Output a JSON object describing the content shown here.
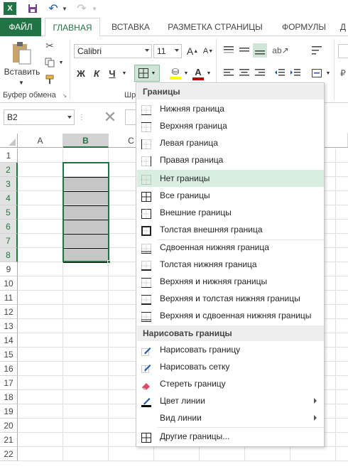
{
  "title_bar": {
    "app_icon": "excel-icon",
    "quick_access": [
      "save-icon",
      "undo-icon",
      "redo-icon"
    ]
  },
  "tabs": [
    "ФАЙЛ",
    "ГЛАВНАЯ",
    "ВСТАВКА",
    "РАЗМЕТКА СТРАНИЦЫ",
    "ФОРМУЛЫ",
    "Д"
  ],
  "active_tab": "ГЛАВНАЯ",
  "ribbon": {
    "paste_label": "Вставить",
    "clipboard_group": "Буфер обмена",
    "font_group_partial": "Шр",
    "font_name": "Calibri",
    "font_size": "11",
    "bold": "Ж",
    "italic": "К",
    "underline": "Ч",
    "grow_font": "A",
    "shrink_font": "A",
    "font_color_letter": "A",
    "font_color": "#c00000",
    "fill_color": "#ffff00"
  },
  "name_box": "B2",
  "columns": [
    "A",
    "B",
    "C"
  ],
  "rows": [
    "1",
    "2",
    "3",
    "4",
    "5",
    "6",
    "7",
    "8",
    "9",
    "10",
    "11",
    "12",
    "13",
    "14",
    "15",
    "16",
    "17",
    "18",
    "19",
    "20",
    "21",
    "22"
  ],
  "selected_rows": [
    "2",
    "3",
    "4",
    "5",
    "6",
    "7",
    "8"
  ],
  "selected_column": "B",
  "accent_color": "#217346",
  "borders_menu": {
    "header1": "Границы",
    "items1": [
      {
        "label": "Нижняя граница",
        "icon": "border-bottom-icon"
      },
      {
        "label": "Верхняя граница",
        "icon": "border-top-icon"
      },
      {
        "label": "Левая граница",
        "icon": "border-left-icon"
      },
      {
        "label": "Правая граница",
        "icon": "border-right-icon"
      }
    ],
    "items2": [
      {
        "label": "Нет границы",
        "icon": "no-border-icon",
        "highlighted": true
      },
      {
        "label": "Все границы",
        "icon": "all-borders-icon"
      },
      {
        "label": "Внешние границы",
        "icon": "outside-borders-icon"
      },
      {
        "label": "Толстая внешняя граница",
        "icon": "thick-outside-border-icon"
      }
    ],
    "items3": [
      {
        "label": "Сдвоенная нижняя граница",
        "icon": "double-bottom-border-icon"
      },
      {
        "label": "Толстая нижняя граница",
        "icon": "thick-bottom-border-icon"
      },
      {
        "label": "Верхняя и нижняя границы",
        "icon": "top-bottom-border-icon"
      },
      {
        "label": "Верхняя и толстая нижняя границы",
        "icon": "top-thick-bottom-border-icon"
      },
      {
        "label": "Верхняя и сдвоенная нижняя границы",
        "icon": "top-double-bottom-border-icon"
      }
    ],
    "header2": "Нарисовать границы",
    "items4": [
      {
        "label": "Нарисовать границу",
        "icon": "draw-border-icon"
      },
      {
        "label": "Нарисовать сетку",
        "icon": "draw-grid-icon"
      },
      {
        "label": "Стереть границу",
        "icon": "eraser-icon"
      },
      {
        "label": "Цвет линии",
        "icon": "line-color-icon",
        "submenu": true
      },
      {
        "label": "Вид линии",
        "icon": "",
        "submenu": true
      }
    ],
    "items5": [
      {
        "label": "Другие границы...",
        "icon": "more-borders-icon"
      }
    ]
  }
}
